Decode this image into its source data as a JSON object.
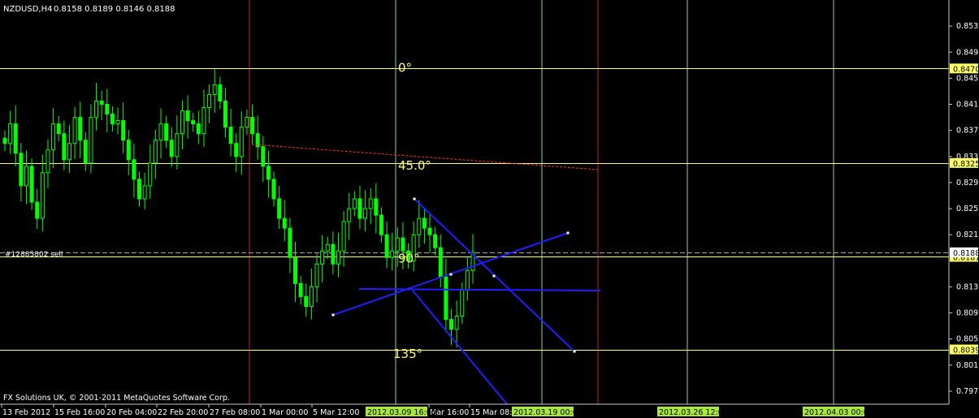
{
  "header": {
    "symbol": "NZDUSD,H4",
    "ohlc": "0.8158 0.8189 0.8146 0.8188"
  },
  "copyright": "FX Solutions UK, © 2001-2011 MetaQuotes Software Corp.",
  "order_label": "#12885802 sell",
  "colors": {
    "background": "#000000",
    "candles": "#00ff00",
    "grid_green": "#8fd48f",
    "grid_red": "#c82222",
    "horizontal_lines": "#ffff66",
    "trendlines": "#1e1eff",
    "date_highlight": "#a8e93c",
    "dashed_trend": "#ff3030"
  },
  "chart_data": {
    "type": "candlestick",
    "symbol": "NZDUSD",
    "timeframe": "H4",
    "y_range": [
      0.7955,
      0.8575
    ],
    "y_ticks": [
      0.8535,
      0.8495,
      0.8455,
      0.8415,
      0.8375,
      0.8335,
      0.8295,
      0.8255,
      0.8215,
      0.8135,
      0.8095,
      0.8055,
      0.8015,
      0.7975
    ],
    "x_tick_labels": [
      "13 Feb 2012",
      "15 Feb 16:00",
      "20 Feb 04:00",
      "22 Feb 20:00",
      "27 Feb 08:00",
      "1 Mar 00:00",
      "5 Mar 12:00",
      "Mar 16:00",
      "15 Mar 08:00"
    ],
    "highlighted_dates": [
      "2012.03.09 16:00",
      "2012.03.19 00:00",
      "2012.03.26 12:00",
      "2012.04.03 00:00"
    ],
    "horizontal_levels": [
      {
        "price": 0.847,
        "label": "0.8470"
      },
      {
        "price": 0.8325,
        "label": "0.8325"
      },
      {
        "price": 0.8181,
        "label": "0.8181"
      },
      {
        "price": 0.8039,
        "label": "0.8039"
      }
    ],
    "order_level": {
      "price": 0.8188,
      "label": "0.8188"
    },
    "angle_labels": [
      "0°",
      "45.0°",
      "90°",
      "135°"
    ],
    "closes": [
      0.8355,
      0.8385,
      0.834,
      0.829,
      0.832,
      0.8265,
      0.824,
      0.831,
      0.8345,
      0.8385,
      0.837,
      0.833,
      0.8355,
      0.8395,
      0.836,
      0.8325,
      0.8395,
      0.842,
      0.8415,
      0.84,
      0.8385,
      0.839,
      0.836,
      0.833,
      0.83,
      0.827,
      0.829,
      0.8325,
      0.836,
      0.8385,
      0.836,
      0.8335,
      0.837,
      0.8405,
      0.839,
      0.8385,
      0.837,
      0.841,
      0.843,
      0.8445,
      0.842,
      0.838,
      0.8355,
      0.8335,
      0.838,
      0.8395,
      0.837,
      0.835,
      0.832,
      0.83,
      0.827,
      0.824,
      0.8225,
      0.818,
      0.814,
      0.812,
      0.8105,
      0.8135,
      0.817,
      0.819,
      0.82,
      0.817,
      0.819,
      0.8235,
      0.8255,
      0.827,
      0.824,
      0.8255,
      0.827,
      0.8245,
      0.8215,
      0.818,
      0.819,
      0.821,
      0.819,
      0.8175,
      0.8215,
      0.824,
      0.8225,
      0.8215,
      0.8195,
      0.815,
      0.8085,
      0.807,
      0.809,
      0.813,
      0.816,
      0.8188
    ],
    "angle_points": [
      {
        "label": "0°",
        "price": 0.8465
      },
      {
        "label": "45.0°",
        "price": 0.8315
      },
      {
        "label": "90°",
        "price": 0.8172
      },
      {
        "label": "135°",
        "price": 0.8026
      }
    ]
  }
}
